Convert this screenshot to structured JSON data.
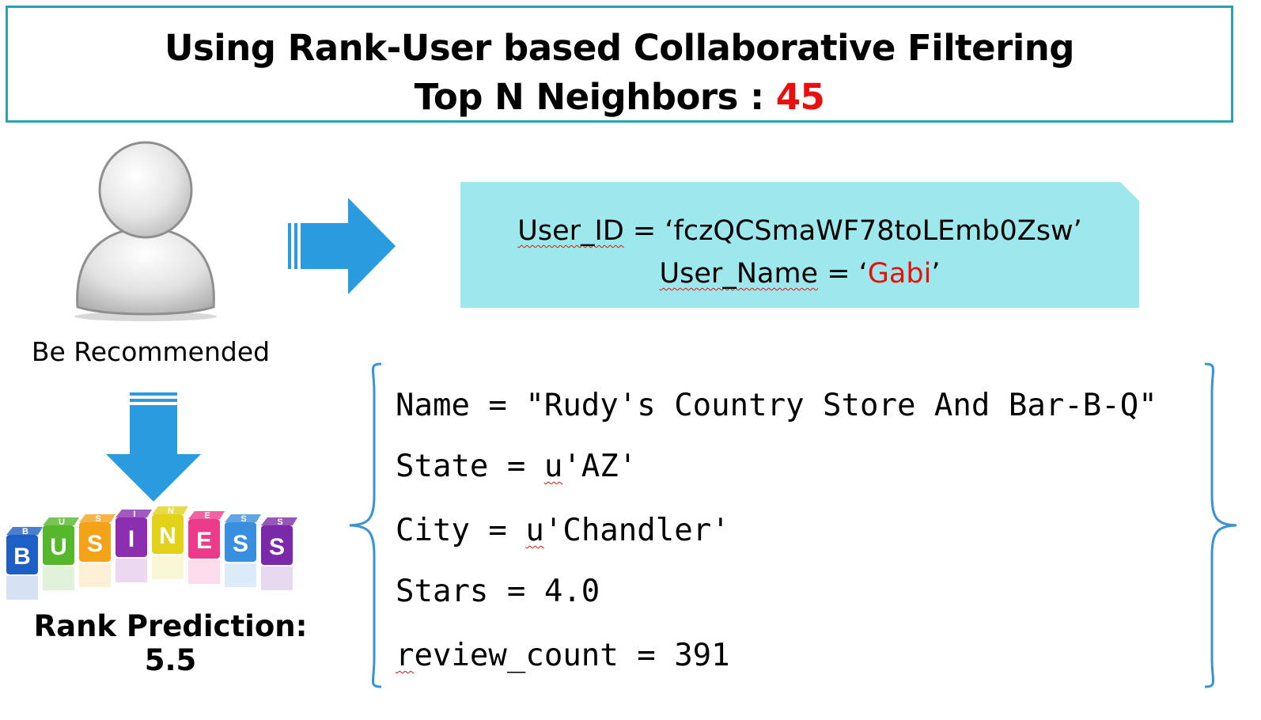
{
  "header": {
    "title": "Using Rank-User based Collaborative Filtering",
    "neighbors_label": "Top N Neighbors : ",
    "neighbors_value": "45"
  },
  "user": {
    "caption": "Be Recommended",
    "id_key": "User_ID",
    "id_eq": " = ‘fczQCSmaWF78toLEmb0Zsw’",
    "name_key": "User_Name",
    "name_eq": " = ‘",
    "name_value": "Gabi",
    "name_close": "’"
  },
  "business": {
    "block_letters_top": [
      "B",
      "U",
      "S",
      "I",
      "N",
      "E",
      "S",
      "S"
    ],
    "block_letters_front": [
      "B",
      "U",
      "S",
      "I",
      "N",
      "E",
      "S",
      "S"
    ],
    "block_colors": [
      "#1d5fc4",
      "#55b82b",
      "#f3a21a",
      "#8b2fb0",
      "#e3d21a",
      "#ec3b8a",
      "#3a8ee0",
      "#7a2aa8"
    ],
    "rank_prediction": "Rank Prediction: 5.5",
    "name_line": "Name = \"Rudy's Country Store And Bar-B-Q\"",
    "state_key": "State = ",
    "state_u": "u",
    "state_rest": "'AZ'",
    "city_key": "City = ",
    "city_u": "u",
    "city_rest": "'Chandler'",
    "stars_line": "Stars = 4.0",
    "review_r": "r",
    "review_rest": "eview_count = 391"
  },
  "colors": {
    "header_border": "#2aa3b5",
    "highlight_red": "#e8100c",
    "id_box_bg": "#9ce8ec",
    "arrow_blue": "#2b9be0",
    "brace_blue": "#3a93d6"
  },
  "icons": {
    "avatar": "user-avatar-icon",
    "arrow_right": "arrow-right-icon",
    "arrow_down": "arrow-down-icon"
  }
}
